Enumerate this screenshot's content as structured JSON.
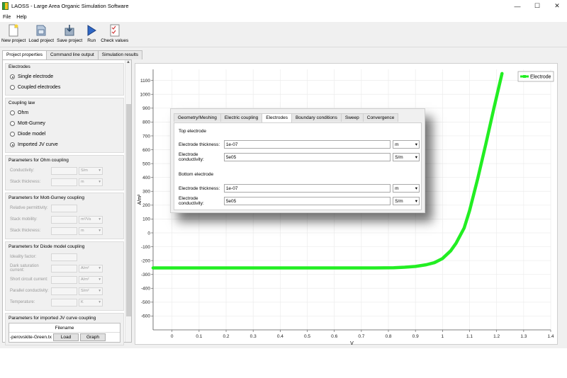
{
  "window": {
    "title": "LAOSS - Large Area Organic Simulation Software",
    "controls": [
      "—",
      "☐",
      "✕"
    ]
  },
  "menu": [
    "File",
    "Help"
  ],
  "toolbar": [
    {
      "label": "New project",
      "icon": "new-document-icon"
    },
    {
      "label": "Load project",
      "icon": "load-folder-icon"
    },
    {
      "label": "Save project",
      "icon": "save-disk-icon"
    },
    {
      "label": "Run",
      "icon": "run-arrow-icon"
    },
    {
      "label": "Check values",
      "icon": "checklist-icon"
    }
  ],
  "tabs": [
    "Project properties",
    "Command line output",
    "Simulation results"
  ],
  "left": {
    "electrodes": {
      "title": "Electrodes",
      "options": [
        "Single electrode",
        "Coupled electrodes"
      ]
    },
    "coupling": {
      "title": "Coupling law",
      "options": [
        "Ohm",
        "Mott-Gurney",
        "Diode model",
        "Imported JV curve"
      ]
    },
    "ohm": {
      "title": "Parameters for Ohm coupling",
      "rows": [
        {
          "label": "Conductivity:",
          "unit": "S/m"
        },
        {
          "label": "Stack thickness:",
          "unit": "m"
        }
      ]
    },
    "mott": {
      "title": "Parameters for Mott-Gurney coupling",
      "rows": [
        {
          "label": "Relative permittivity:",
          "unit": ""
        },
        {
          "label": "Stack mobility:",
          "unit": "m²/Vs"
        },
        {
          "label": "Stack thickness:",
          "unit": "m"
        }
      ]
    },
    "diode": {
      "title": "Parameters for Diode model coupling",
      "rows": [
        {
          "label": "Ideality factor:",
          "unit": ""
        },
        {
          "label": "Dark saturation current:",
          "unit": "A/m²"
        },
        {
          "label": "Short circuit current:",
          "unit": "A/m²"
        },
        {
          "label": "Parallel conductivity:",
          "unit": "S/m²"
        },
        {
          "label": "Temperature:",
          "unit": "K"
        }
      ]
    },
    "imported": {
      "title": "Parameters for imported JV curve coupling",
      "header": "Filename",
      "file": "-perovskite-Green.txt",
      "load": "Load",
      "graph": "Graph"
    }
  },
  "dialog": {
    "tabs": [
      "Geometry/Meshing",
      "Electric coupling",
      "Electrodes",
      "Boundary conditions",
      "Sweep",
      "Convergence"
    ],
    "top_title": "Top electrode",
    "bottom_title": "Bottom electrode",
    "top": [
      {
        "label": "Electrode thickness:",
        "value": "1e-07",
        "unit": "m"
      },
      {
        "label": "Electrode conductivity:",
        "value": "5e05",
        "unit": "S/m"
      }
    ],
    "bottom": [
      {
        "label": "Electrode thickness:",
        "value": "1e-07",
        "unit": "m"
      },
      {
        "label": "Electrode conductivity:",
        "value": "5e05",
        "unit": "S/m"
      }
    ]
  },
  "chart_data": {
    "type": "line",
    "xlabel": "V",
    "ylabel": "A/m²",
    "xlim": [
      -0.07,
      1.4
    ],
    "ylim": [
      -700,
      1180
    ],
    "xticks": [
      0,
      0.1,
      0.2,
      0.3,
      0.4,
      0.5,
      0.6,
      0.7,
      0.8,
      0.9,
      1,
      1.1,
      1.2,
      1.3,
      1.4
    ],
    "yticks": [
      -600,
      -500,
      -400,
      -300,
      -200,
      -100,
      0,
      100,
      200,
      300,
      400,
      500,
      600,
      700,
      800,
      900,
      1000,
      1100
    ],
    "legend": "top-right",
    "series": [
      {
        "name": "Electrode",
        "color": "#22ee22",
        "x": [
          -0.07,
          0.0,
          0.2,
          0.4,
          0.6,
          0.75,
          0.82,
          0.86,
          0.9,
          0.94,
          0.97,
          1.0,
          1.03,
          1.05,
          1.08,
          1.1,
          1.13,
          1.16,
          1.19,
          1.22
        ],
        "y": [
          -253,
          -253,
          -253,
          -253,
          -253,
          -253,
          -252,
          -248,
          -242,
          -230,
          -215,
          -185,
          -130,
          -75,
          35,
          160,
          390,
          640,
          900,
          1150
        ]
      }
    ]
  }
}
